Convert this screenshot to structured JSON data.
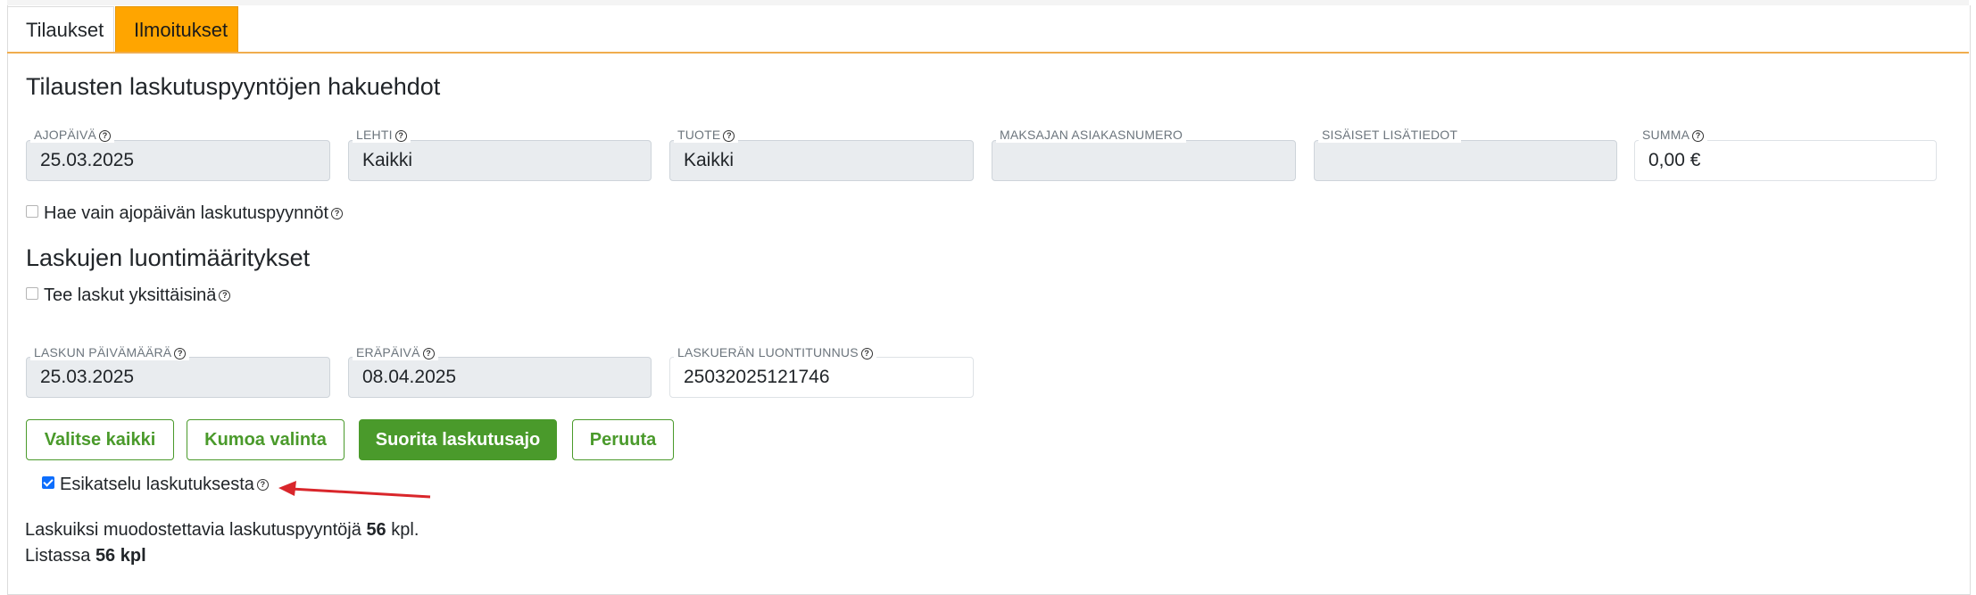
{
  "tabs": [
    {
      "label": "Tilaukset"
    },
    {
      "label": "Ilmoitukset"
    }
  ],
  "search": {
    "heading": "Tilausten laskutuspyyntöjen hakuehdot",
    "fields": [
      {
        "label": "AJOPÄIVÄ",
        "value": "25.03.2025"
      },
      {
        "label": "LEHTI",
        "value": "Kaikki"
      },
      {
        "label": "TUOTE",
        "value": "Kaikki"
      },
      {
        "label": "MAKSAJAN ASIAKASNUMERO",
        "value": ""
      },
      {
        "label": "SISÄISET LISÄTIEDOT",
        "value": ""
      },
      {
        "label": "SUMMA",
        "value": "0,00 €"
      }
    ],
    "only_run_day_label": "Hae vain ajopäivän laskutuspyynnöt",
    "only_run_day_checked": false
  },
  "invoice": {
    "heading": "Laskujen luontimääritykset",
    "individual_label": "Tee laskut yksittäisinä",
    "individual_checked": false,
    "fields": [
      {
        "label": "LASKUN PÄIVÄMÄÄRÄ",
        "value": "25.03.2025"
      },
      {
        "label": "ERÄPÄIVÄ",
        "value": "08.04.2025"
      },
      {
        "label": "LASKUERÄN LUONTITUNNUS",
        "value": "25032025121746"
      }
    ]
  },
  "buttons": {
    "select_all": "Valitse kaikki",
    "undo_selection": "Kumoa valinta",
    "run_billing": "Suorita laskutusajo",
    "cancel": "Peruuta"
  },
  "preview": {
    "label": "Esikatselu laskutuksesta",
    "checked": true
  },
  "summary": {
    "line1_prefix": "Laskuiksi muodostettavia laskutuspyyntöjä",
    "line1_count": "56",
    "line1_suffix": "kpl.",
    "line2_prefix": "Listassa",
    "line2_count": "56 kpl"
  },
  "colors": {
    "tab_active_bg": "#ffa500",
    "accent_green": "#4a9a2b",
    "annotation_arrow": "#d9262b"
  }
}
